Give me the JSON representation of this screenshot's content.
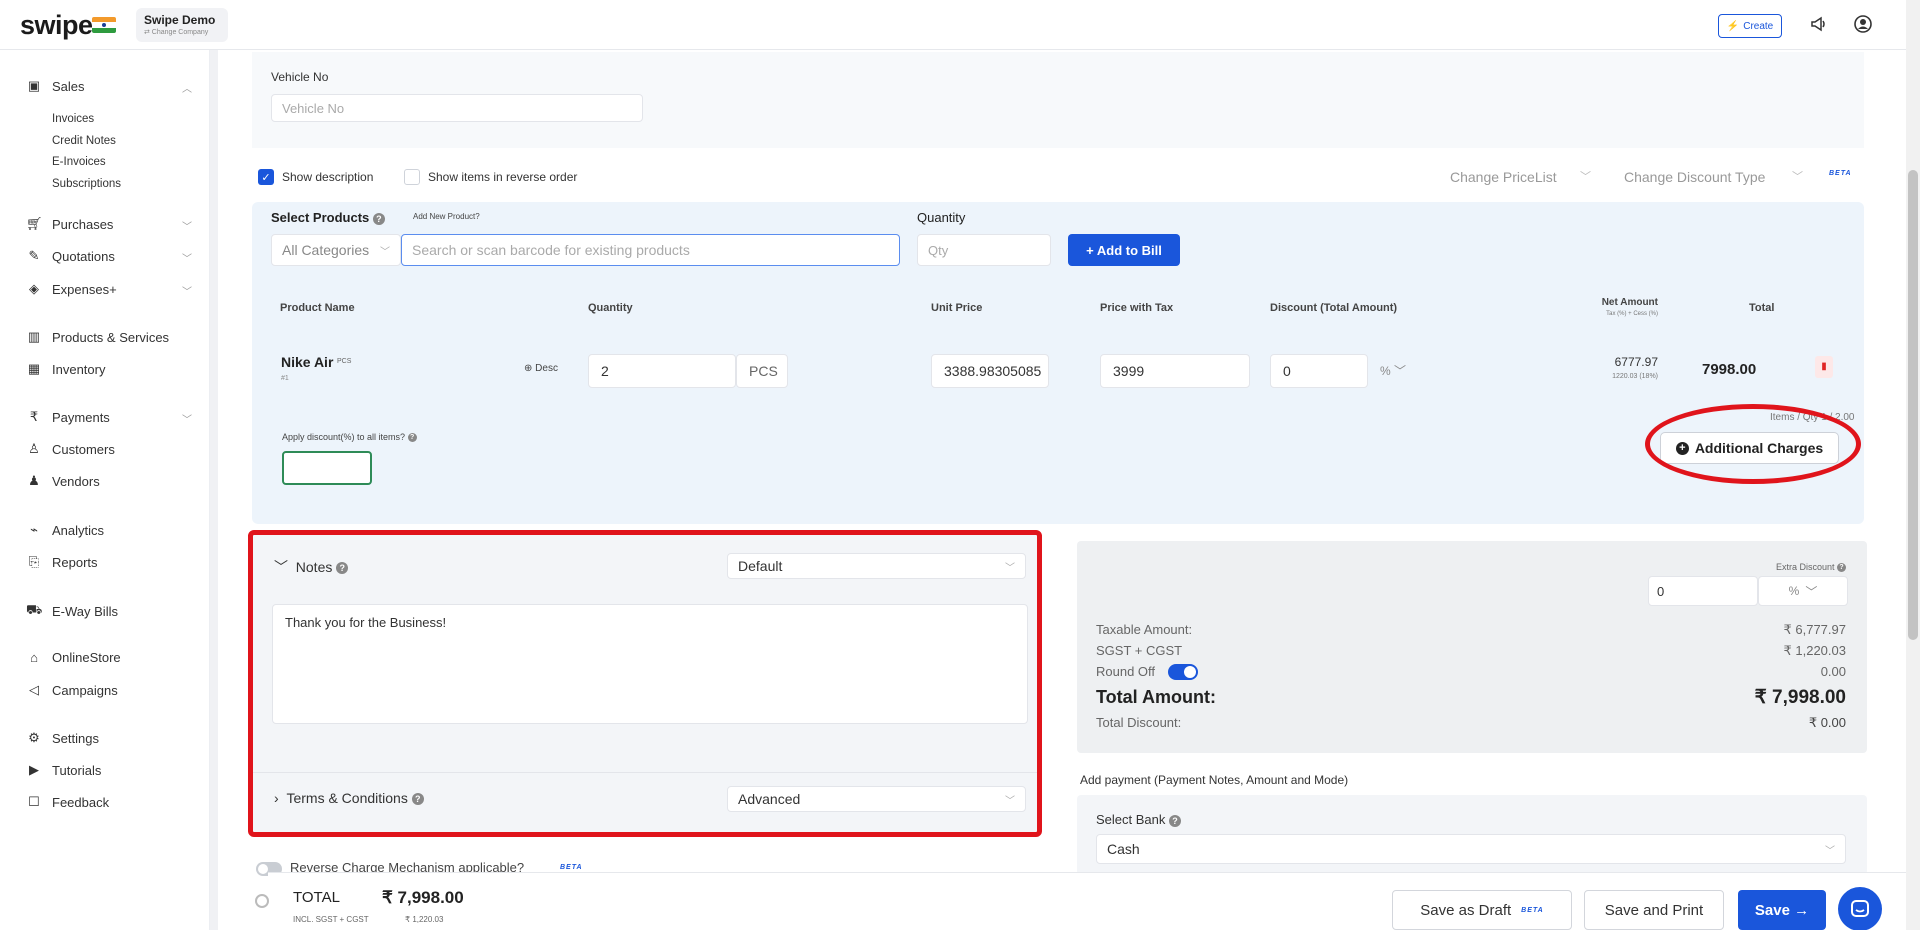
{
  "header": {
    "logo": "swipe",
    "company_name": "Swipe Demo",
    "company_sub": "⇄ Change Company",
    "create_label": "Create"
  },
  "sidebar": {
    "sales": "Sales",
    "sales_sub": [
      "Invoices",
      "Credit Notes",
      "E-Invoices",
      "Subscriptions"
    ],
    "purchases": "Purchases",
    "quotations": "Quotations",
    "expenses": "Expenses+",
    "products": "Products & Services",
    "inventory": "Inventory",
    "payments": "Payments",
    "customers": "Customers",
    "vendors": "Vendors",
    "analytics": "Analytics",
    "reports": "Reports",
    "eway": "E-Way Bills",
    "onlinestore": "OnlineStore",
    "campaigns": "Campaigns",
    "settings": "Settings",
    "tutorials": "Tutorials",
    "feedback": "Feedback"
  },
  "vehicle": {
    "label": "Vehicle No",
    "placeholder": "Vehicle No"
  },
  "options": {
    "show_description": "Show description",
    "show_reverse": "Show items in reverse order",
    "change_pricelist": "Change PriceList",
    "change_discount": "Change Discount Type",
    "beta": "BETA"
  },
  "product_select": {
    "label": "Select Products",
    "add_new": "Add New Product?",
    "category": "All Categories",
    "search_placeholder": "Search or scan barcode for existing products",
    "quantity_label": "Quantity",
    "qty_placeholder": "Qty",
    "add_to_bill": "+ Add to Bill"
  },
  "table": {
    "headers": {
      "product_name": "Product Name",
      "quantity": "Quantity",
      "unit_price": "Unit Price",
      "price_with_tax": "Price with Tax",
      "discount": "Discount (Total Amount)",
      "net_amount": "Net Amount",
      "net_sub": "Tax (%) + Cess (%)",
      "total": "Total"
    },
    "row": {
      "name": "Nike Air",
      "unit": "PCS",
      "index": "#1",
      "desc": "Desc",
      "quantity": "2",
      "qty_unit": "PCS",
      "unit_price": "3388.98305085",
      "price_with_tax": "3999",
      "discount": "0",
      "discount_type": "%",
      "net_amount": "6777.97",
      "net_tax": "1220.03 (18%)",
      "total": "7998.00"
    },
    "items_qty": "Items / Qty 1 / 2.00",
    "apply_discount": "Apply discount(%) to all items?",
    "additional_charges": "Additional Charges"
  },
  "notes": {
    "label": "Notes",
    "select": "Default",
    "text": "Thank you for the Business!",
    "terms_label": "Terms & Conditions",
    "terms_select": "Advanced"
  },
  "summary": {
    "extra_discount": "Extra Discount",
    "extra_value": "0",
    "extra_type": "%",
    "taxable_label": "Taxable Amount:",
    "taxable_value": "₹ 6,777.97",
    "sgst_label": "SGST + CGST",
    "sgst_value": "₹ 1,220.03",
    "roundoff_label": "Round Off",
    "roundoff_value": "0.00",
    "total_label": "Total Amount:",
    "total_value": "₹ 7,998.00",
    "total_discount_label": "Total Discount:",
    "total_discount_value": "₹ 0.00"
  },
  "payment": {
    "title": "Add payment (Payment Notes, Amount and Mode)",
    "bank_label": "Select Bank",
    "bank_value": "Cash"
  },
  "reverse_charge": "Reverse Charge Mechanism applicable?",
  "bottom": {
    "total_label": "TOTAL",
    "total_value": "₹ 7,998.00",
    "tax_label": "INCL. SGST + CGST",
    "tax_value": "₹ 1,220.03",
    "save_draft": "Save as Draft",
    "save_print": "Save and Print",
    "save": "Save →"
  },
  "colors": {
    "primary": "#1a56db",
    "highlight": "#e0141b"
  }
}
